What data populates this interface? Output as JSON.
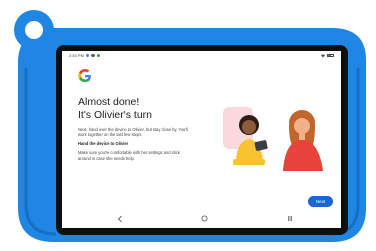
{
  "status_bar": {
    "time": "2:53 PM",
    "accent_colors": [
      "#4285F4",
      "#5f6368",
      "#34A853"
    ]
  },
  "setup": {
    "logo": "google-g-logo",
    "title_line1": "Almost done!",
    "title_line2": "It's Olivier's turn",
    "paragraph1": "Next, hand over the device to Olivier, but stay close by. You'll work together on the last few steps.",
    "paragraph2": "Hand the device to Olivier",
    "paragraph3": "Make sure you're comfortable with her settings and stick around in case she needs help.",
    "next_label": "Next",
    "illustration": "parent-and-child-illustration"
  },
  "navigation": {
    "back": "back-icon",
    "home": "home-icon",
    "recents": "recents-icon"
  },
  "colors": {
    "bumper": "#1f86e3",
    "primary_button": "#1a66d4"
  }
}
